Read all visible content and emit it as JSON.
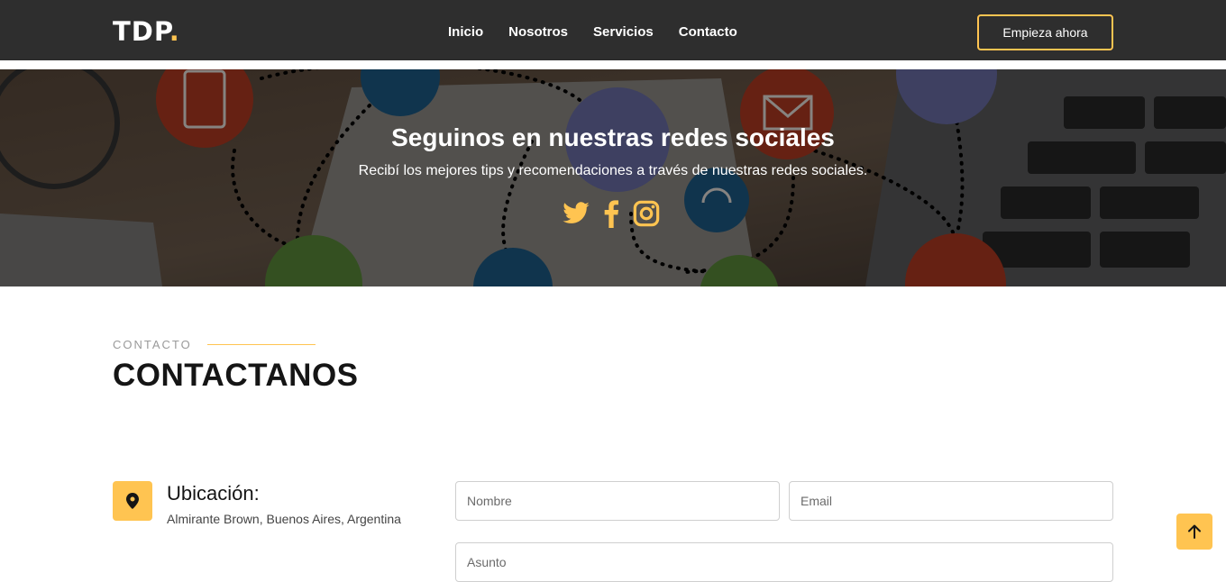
{
  "header": {
    "logo_text": "TDP",
    "logo_dot": ".",
    "nav": [
      "Inicio",
      "Nosotros",
      "Servicios",
      "Contacto"
    ],
    "cta_label": "Empieza ahora"
  },
  "hero": {
    "title": "Seguinos en nuestras redes sociales",
    "subtitle": "Recibí los mejores tips y recomendaciones a través de nuestras redes sociales.",
    "social_icons": [
      "twitter-icon",
      "facebook-icon",
      "instagram-icon"
    ]
  },
  "contact": {
    "label": "CONTACTO",
    "title": "CONTACTANOS",
    "location_title": "Ubicación:",
    "location_text": "Almirante Brown, Buenos Aires, Argentina",
    "form": {
      "name_placeholder": "Nombre",
      "email_placeholder": "Email",
      "subject_placeholder": "Asunto"
    }
  },
  "colors": {
    "accent": "#ffc451",
    "header_bg": "#2e2e2e"
  }
}
